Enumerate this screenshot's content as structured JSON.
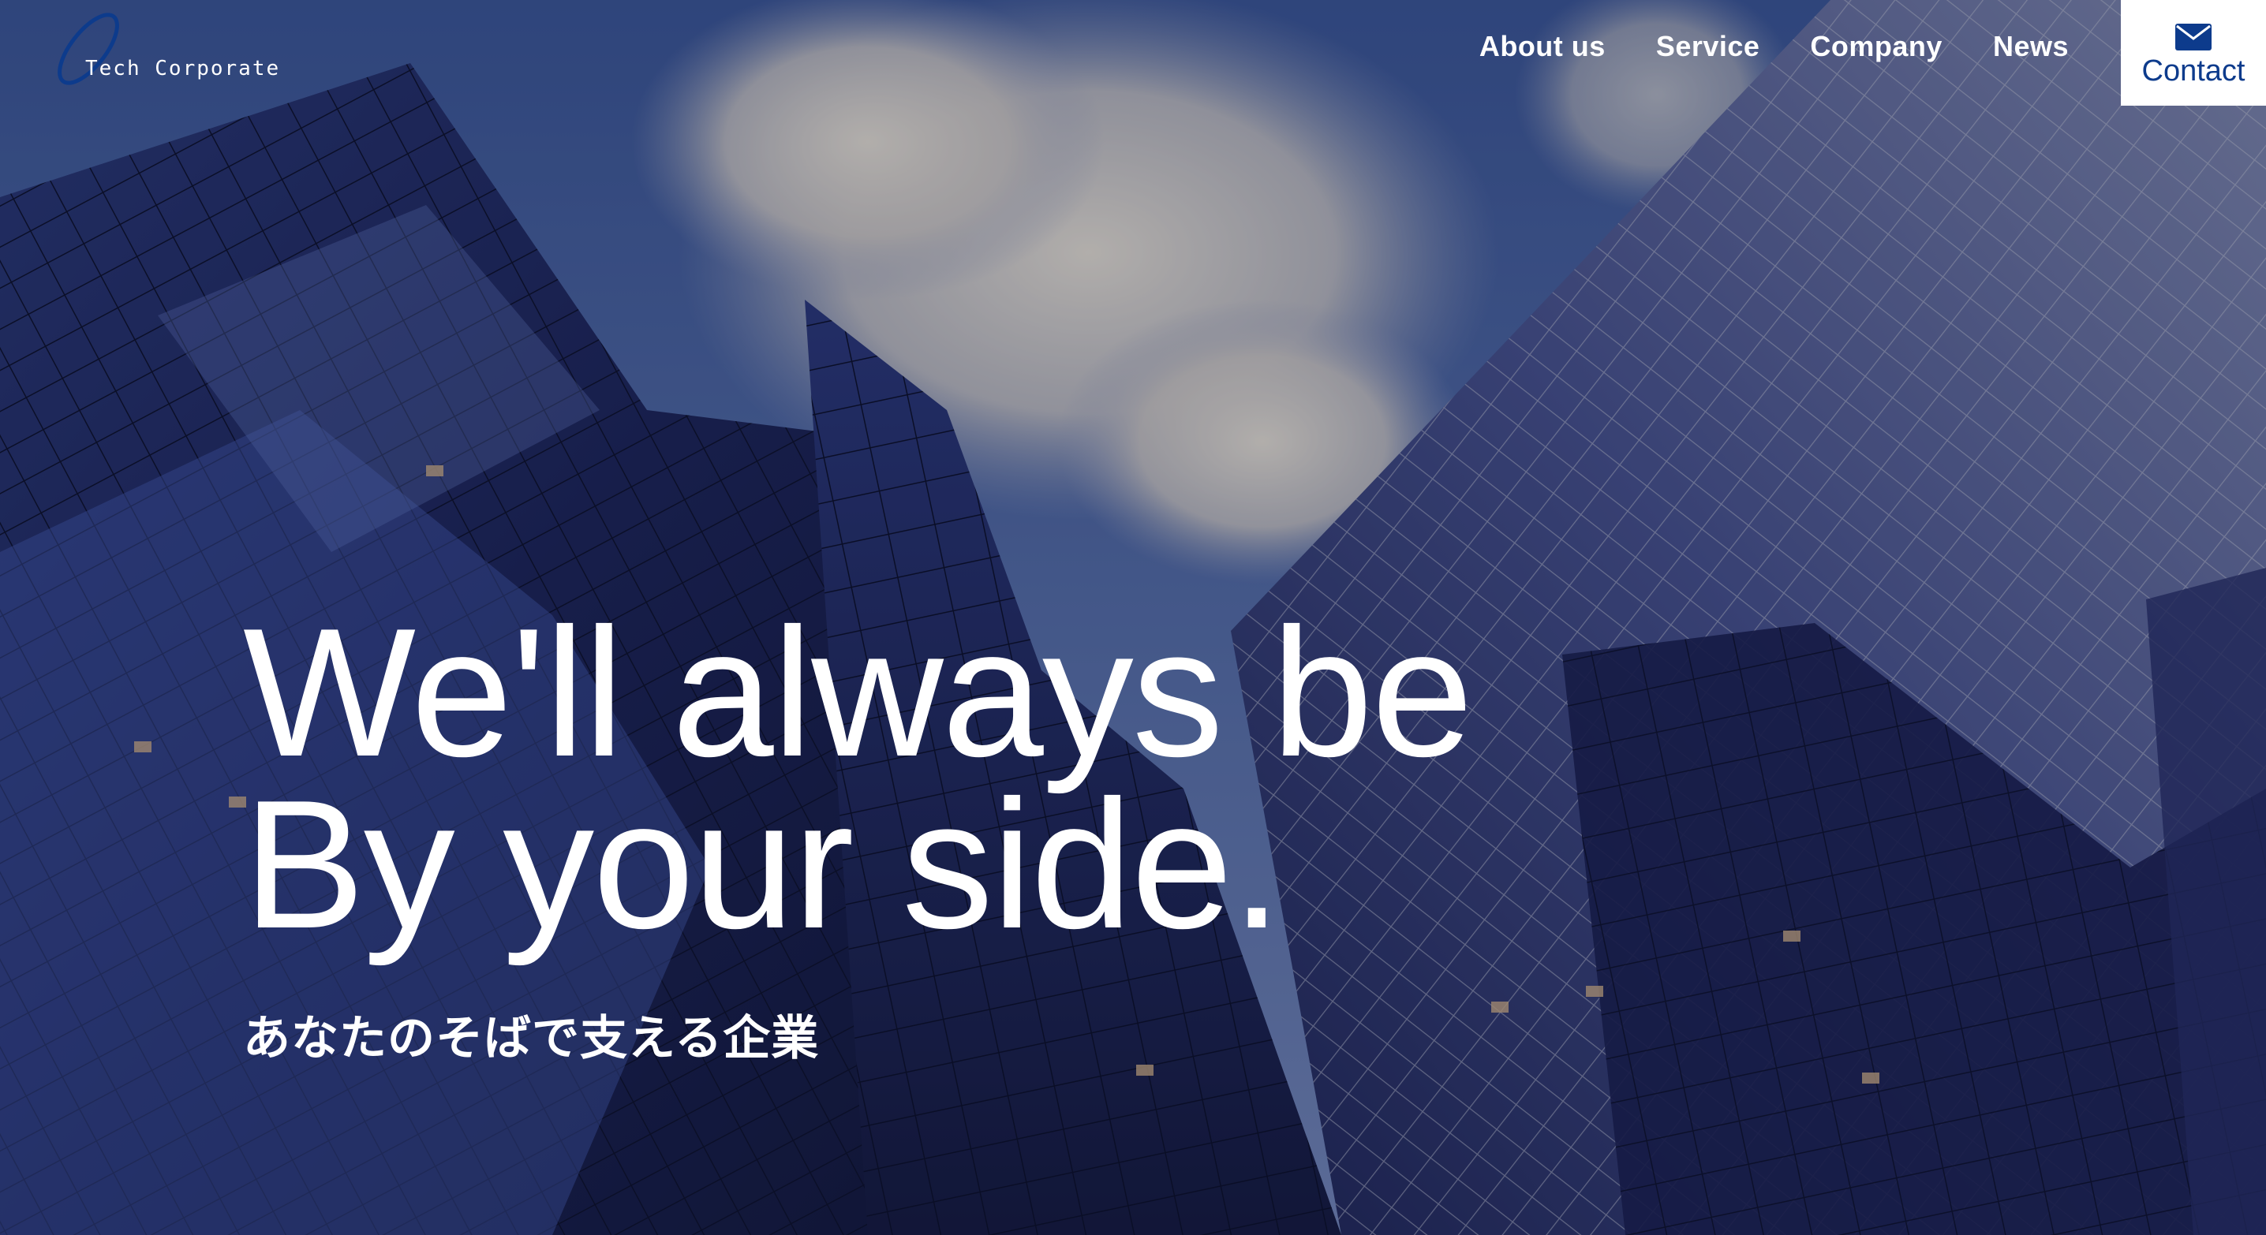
{
  "brand": {
    "name": "Tech Corporate",
    "accent": "#0d3b8c"
  },
  "nav": {
    "items": [
      {
        "label": "About us"
      },
      {
        "label": "Service"
      },
      {
        "label": "Company"
      },
      {
        "label": "News"
      }
    ],
    "contact_label": "Contact",
    "contact_icon": "mail-icon"
  },
  "hero": {
    "headline_line1": "We'll always be",
    "headline_line2": "By your side.",
    "subheadline": "あなたのそばで支える企業",
    "background": "skyscrapers-against-cloudy-sky"
  }
}
